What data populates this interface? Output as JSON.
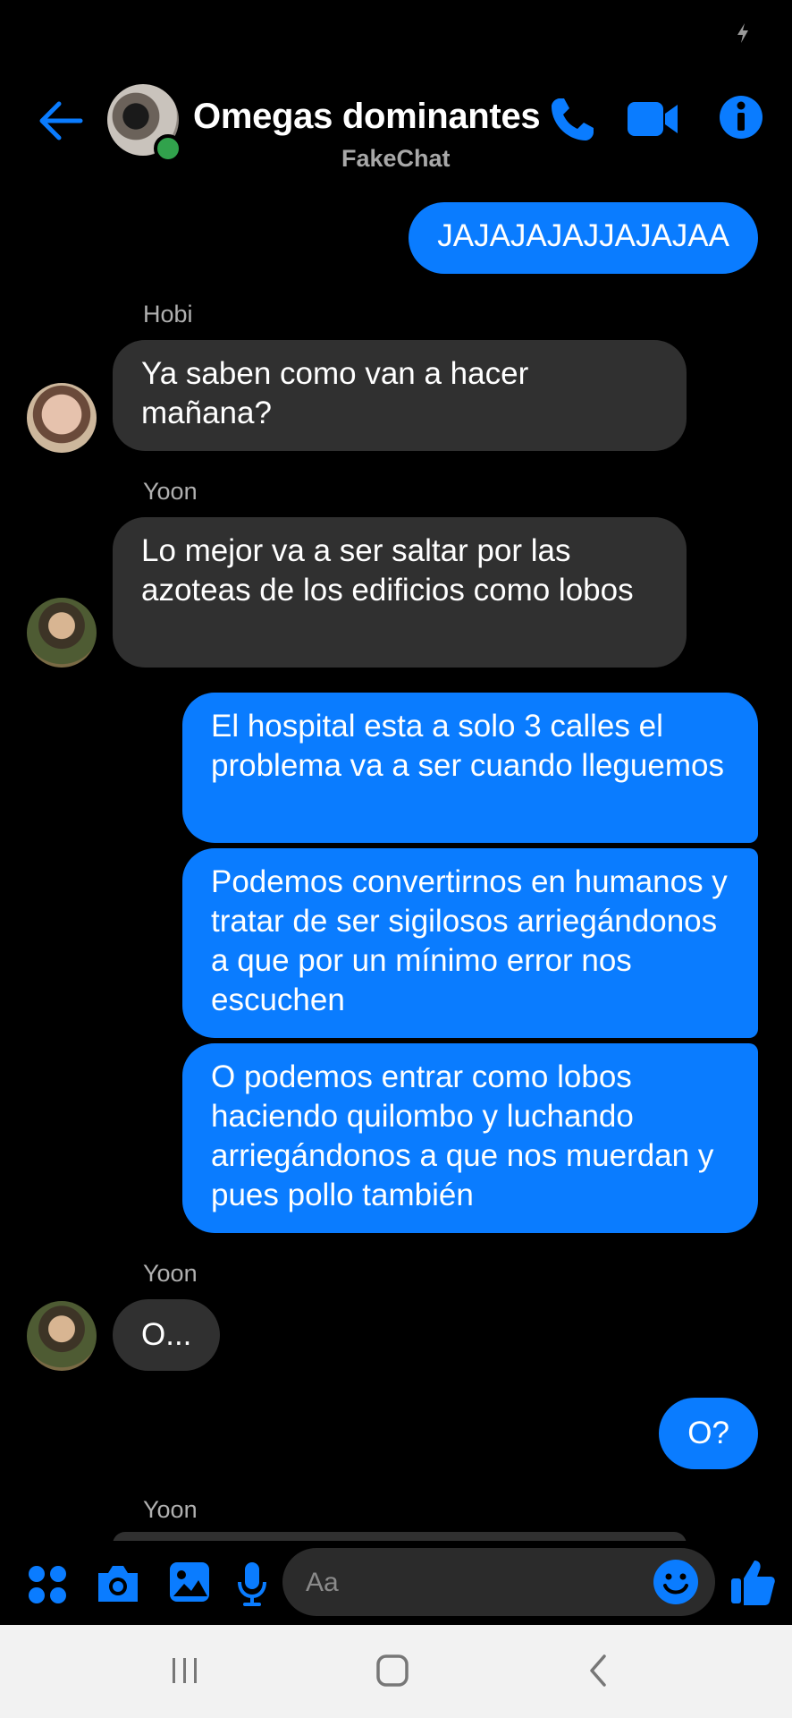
{
  "header": {
    "title": "Omegas dominantes",
    "subtitle": "FakeChat"
  },
  "messages": [
    {
      "type": "out",
      "text": "JAJAJAJAJJAJAJAA"
    },
    {
      "type": "in",
      "sender": "Hobi",
      "text": "Ya saben como van a hacer mañana?"
    },
    {
      "type": "in",
      "sender": "Yoon",
      "text": "Lo mejor va a ser saltar por las azoteas de los edificios como lobos"
    },
    {
      "type": "out",
      "text": "El hospital esta a solo 3 calles el problema va a ser cuando lleguemos"
    },
    {
      "type": "out",
      "text": "Podemos convertirnos en humanos y tratar de ser sigilosos arriegándonos a que por un mínimo error nos escuchen"
    },
    {
      "type": "out",
      "text": "O podemos entrar como lobos haciendo quilombo y luchando arriegándonos a que nos muerdan y pues pollo también"
    },
    {
      "type": "in",
      "sender": "Yoon",
      "text": "O..."
    },
    {
      "type": "out",
      "text": "O?"
    },
    {
      "type": "in",
      "sender": "Yoon",
      "text": ""
    }
  ],
  "composer": {
    "placeholder": "Aa"
  },
  "colors": {
    "accent": "#0a7cff",
    "incoming_bubble": "#303030",
    "background": "#000000",
    "online": "#31a24c"
  },
  "icons": [
    "flash-icon",
    "back-arrow-icon",
    "phone-icon",
    "video-camera-icon",
    "info-icon",
    "apps-icon",
    "camera-icon",
    "gallery-icon",
    "microphone-icon",
    "emoji-icon",
    "thumbs-up-icon",
    "recent-apps-icon",
    "home-icon",
    "back-icon"
  ]
}
